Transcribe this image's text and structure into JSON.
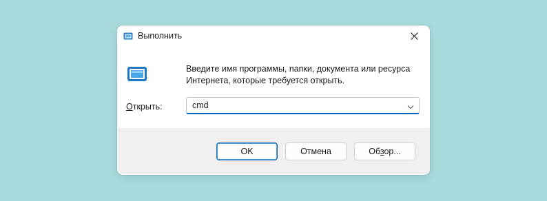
{
  "window": {
    "title": "Выполнить",
    "icon": "run-icon",
    "close_icon": "close-icon"
  },
  "description": "Введите имя программы, папки, документа или ресурса Интернета, которые требуется открыть.",
  "open_field": {
    "label_accel": "О",
    "label_rest": "ткрыть:",
    "value": "cmd",
    "dropdown_icon": "chevron-down-icon"
  },
  "buttons": {
    "ok": "OK",
    "cancel": "Отмена",
    "browse_pre": "Об",
    "browse_accel": "з",
    "browse_post": "ор..."
  },
  "colors": {
    "background": "#a8dadc",
    "accent": "#0067c0",
    "footer": "#f0f0f0"
  }
}
